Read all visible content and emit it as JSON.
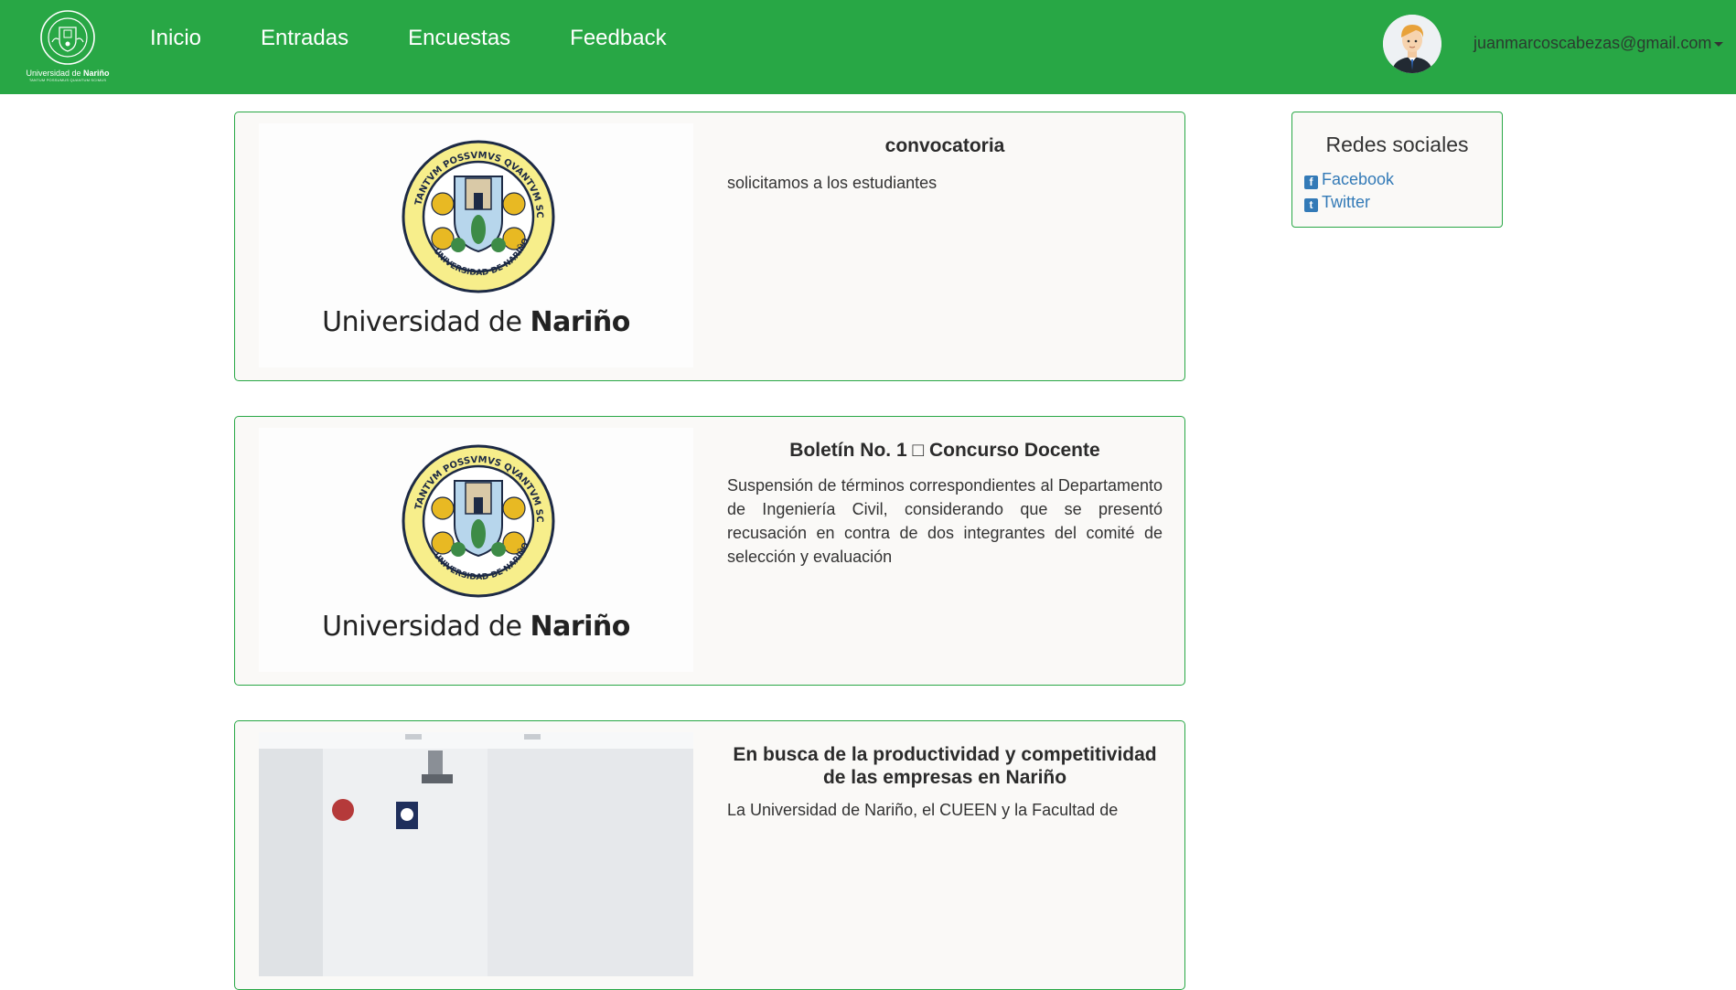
{
  "navbar": {
    "logo_text_plain": "Universidad de ",
    "logo_text_bold": "Nariño",
    "logo_subtext": "TANTUM POSSUMUS QUANTUM SCIMUS",
    "links": [
      {
        "label": "Inicio"
      },
      {
        "label": "Entradas"
      },
      {
        "label": "Encuestas"
      },
      {
        "label": "Feedback"
      }
    ],
    "user_email": "juanmarcoscabezas@gmail.com",
    "background_color": "#28a745"
  },
  "posts": [
    {
      "image": "university-logo",
      "uni_name_plain": "Universidad de ",
      "uni_name_bold": "Nariño",
      "title": "convocatoria",
      "body": "solicitamos a los estudiantes"
    },
    {
      "image": "university-logo",
      "uni_name_plain": "Universidad de ",
      "uni_name_bold": "Nariño",
      "title": "Boletín No. 1 □ Concurso Docente",
      "body": "Suspensión de términos correspondientes al Departamento de Ingeniería Civil, considerando que se presentó recusación en contra de dos integrantes del comité de selección y evaluación"
    },
    {
      "image": "classroom-photo",
      "title": "En busca de la productividad y competitividad de las empresas en Nariño",
      "body": "La Universidad de Nariño, el CUEEN y la Facultad de"
    }
  ],
  "sidebar": {
    "title": "Redes sociales",
    "links": [
      {
        "label": "Facebook",
        "icon": "facebook-icon"
      },
      {
        "label": "Twitter",
        "icon": "twitter-icon"
      }
    ],
    "link_color": "#337ab7"
  }
}
